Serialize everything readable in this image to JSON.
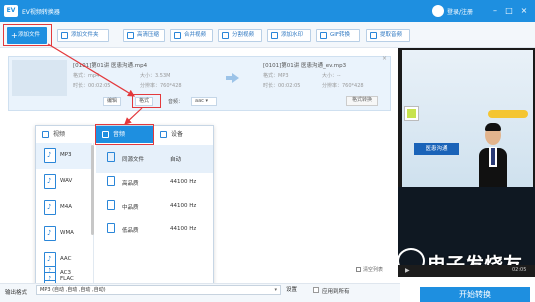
{
  "app": {
    "title": "EV视频转换器",
    "logo": "EV",
    "login": "登录/注册"
  },
  "window_controls": [
    "–",
    "□",
    "×"
  ],
  "toolbar": {
    "add_file": "添加文件",
    "add_folder": "添加文件夹",
    "buttons": [
      "高清压缩",
      "合并视频",
      "分割视频",
      "添加水印",
      "GIF转换",
      "提取音频"
    ]
  },
  "file": {
    "src_name": "[0101]第01讲 医患沟通.mp4",
    "src_format": "格式：mp4",
    "src_size": "大小：3.53M",
    "src_duration": "时长：00:02:05",
    "src_resolution": "分辨率：760*428",
    "dst_name": "[0101]第01讲 医患沟通_ev.mp3",
    "dst_format": "格式：MP3",
    "dst_size": "大小：--",
    "dst_duration": "时长：00:02:05",
    "dst_resolution": "分辨率：760*428",
    "edit": "编辑",
    "format": "格式",
    "audio_label": "音频：",
    "audio_value": "aac",
    "convert": "格式转换"
  },
  "popup": {
    "tabs": [
      "视频",
      "音频",
      "设备"
    ],
    "formats": [
      "MP3",
      "WAV",
      "M4A",
      "WMA",
      "AAC",
      "FLAC",
      "AC3"
    ],
    "qualities": [
      {
        "name": "同源文件",
        "value": "自动"
      },
      {
        "name": "高品质",
        "value": "44100 Hz"
      },
      {
        "name": "中品质",
        "value": "44100 Hz"
      },
      {
        "name": "低品质",
        "value": "44100 Hz"
      }
    ]
  },
  "bottom": {
    "out_label": "输出格式",
    "out_value": "MP3 (自动 ,自动 ,自动 ,自动)",
    "settings": "设置",
    "apply_all": "应用到所有",
    "clear_list": "清空列表",
    "start": "开始转换"
  },
  "preview": {
    "video_title": "医患沟通",
    "time": "02:05",
    "watermark": "电子发烧友"
  }
}
